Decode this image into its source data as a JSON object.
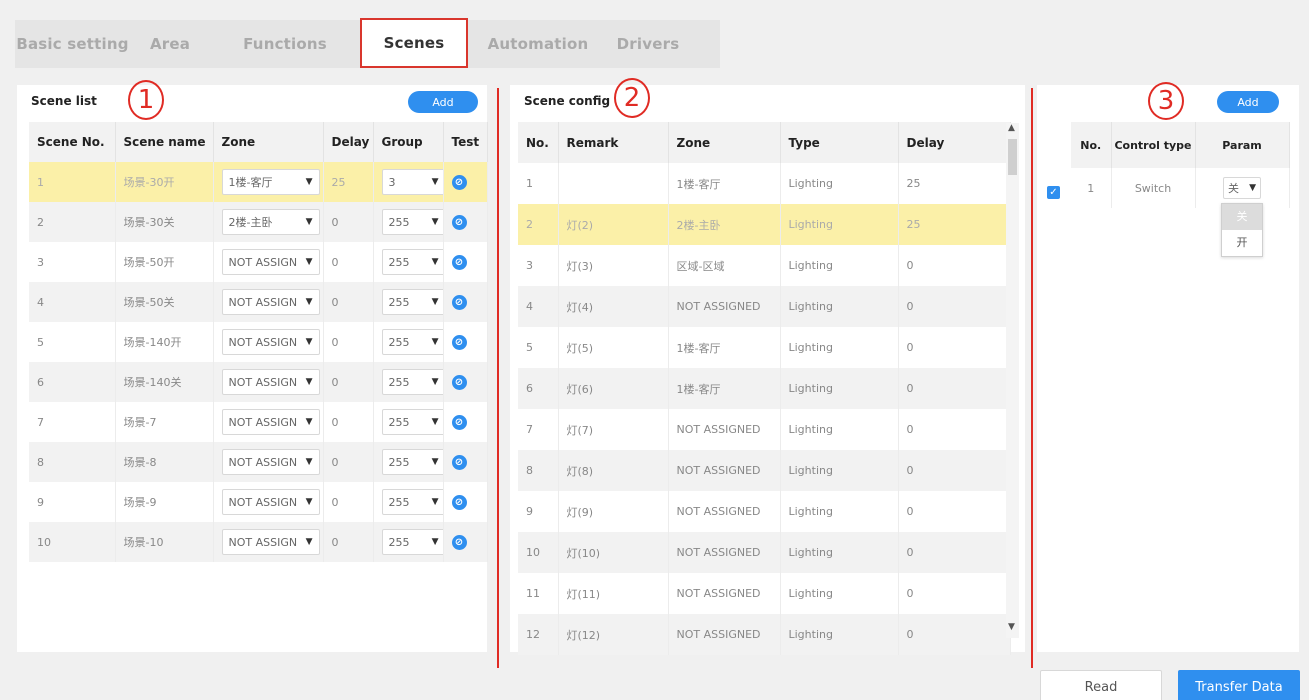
{
  "tabs": [
    "Basic setting",
    "Area",
    "Functions",
    "Scenes",
    "Automation",
    "Drivers"
  ],
  "active_tab": "Scenes",
  "markers": [
    "1",
    "2",
    "3"
  ],
  "scene_list": {
    "title": "Scene list",
    "add_label": "Add",
    "headers": [
      "Scene No.",
      "Scene name",
      "Zone",
      "Delay",
      "Group",
      "Test"
    ],
    "rows": [
      {
        "no": "1",
        "name": "场景-30开",
        "zone": "1楼-客厅",
        "delay": "25",
        "group": "3"
      },
      {
        "no": "2",
        "name": "场景-30关",
        "zone": "2楼-主卧",
        "delay": "0",
        "group": "255"
      },
      {
        "no": "3",
        "name": "场景-50开",
        "zone": "NOT ASSIGN",
        "delay": "0",
        "group": "255"
      },
      {
        "no": "4",
        "name": "场景-50关",
        "zone": "NOT ASSIGN",
        "delay": "0",
        "group": "255"
      },
      {
        "no": "5",
        "name": "场景-140开",
        "zone": "NOT ASSIGN",
        "delay": "0",
        "group": "255"
      },
      {
        "no": "6",
        "name": "场景-140关",
        "zone": "NOT ASSIGN",
        "delay": "0",
        "group": "255"
      },
      {
        "no": "7",
        "name": "场景-7",
        "zone": "NOT ASSIGN",
        "delay": "0",
        "group": "255"
      },
      {
        "no": "8",
        "name": "场景-8",
        "zone": "NOT ASSIGN",
        "delay": "0",
        "group": "255"
      },
      {
        "no": "9",
        "name": "场景-9",
        "zone": "NOT ASSIGN",
        "delay": "0",
        "group": "255"
      },
      {
        "no": "10",
        "name": "场景-10",
        "zone": "NOT ASSIGN",
        "delay": "0",
        "group": "255"
      }
    ]
  },
  "scene_config": {
    "title": "Scene config",
    "headers": [
      "No.",
      "Remark",
      "Zone",
      "Type",
      "Delay"
    ],
    "rows": [
      {
        "no": "1",
        "remark": "",
        "zone": "1楼-客厅",
        "type": "Lighting",
        "delay": "25"
      },
      {
        "no": "2",
        "remark": "灯(2)",
        "zone": "2楼-主卧",
        "type": "Lighting",
        "delay": "25"
      },
      {
        "no": "3",
        "remark": "灯(3)",
        "zone": "区域-区域",
        "type": "Lighting",
        "delay": "0"
      },
      {
        "no": "4",
        "remark": "灯(4)",
        "zone": "NOT ASSIGNED",
        "type": "Lighting",
        "delay": "0"
      },
      {
        "no": "5",
        "remark": "灯(5)",
        "zone": "1楼-客厅",
        "type": "Lighting",
        "delay": "0"
      },
      {
        "no": "6",
        "remark": "灯(6)",
        "zone": "1楼-客厅",
        "type": "Lighting",
        "delay": "0"
      },
      {
        "no": "7",
        "remark": "灯(7)",
        "zone": "NOT ASSIGNED",
        "type": "Lighting",
        "delay": "0"
      },
      {
        "no": "8",
        "remark": "灯(8)",
        "zone": "NOT ASSIGNED",
        "type": "Lighting",
        "delay": "0"
      },
      {
        "no": "9",
        "remark": "灯(9)",
        "zone": "NOT ASSIGNED",
        "type": "Lighting",
        "delay": "0"
      },
      {
        "no": "10",
        "remark": "灯(10)",
        "zone": "NOT ASSIGNED",
        "type": "Lighting",
        "delay": "0"
      },
      {
        "no": "11",
        "remark": "灯(11)",
        "zone": "NOT ASSIGNED",
        "type": "Lighting",
        "delay": "0"
      },
      {
        "no": "12",
        "remark": "灯(12)",
        "zone": "NOT ASSIGNED",
        "type": "Lighting",
        "delay": "0"
      }
    ]
  },
  "control": {
    "add_label": "Add",
    "headers": [
      "No.",
      "Control type",
      "Param"
    ],
    "rows": [
      {
        "no": "1",
        "type": "Switch",
        "param": "关"
      }
    ],
    "param_options": [
      "关",
      "开"
    ]
  },
  "buttons": {
    "read": "Read",
    "transfer": "Transfer Data"
  },
  "colors": {
    "accent": "#2f8fef",
    "selected_row": "#fbf0a8",
    "annotation_red": "#e02b24"
  }
}
